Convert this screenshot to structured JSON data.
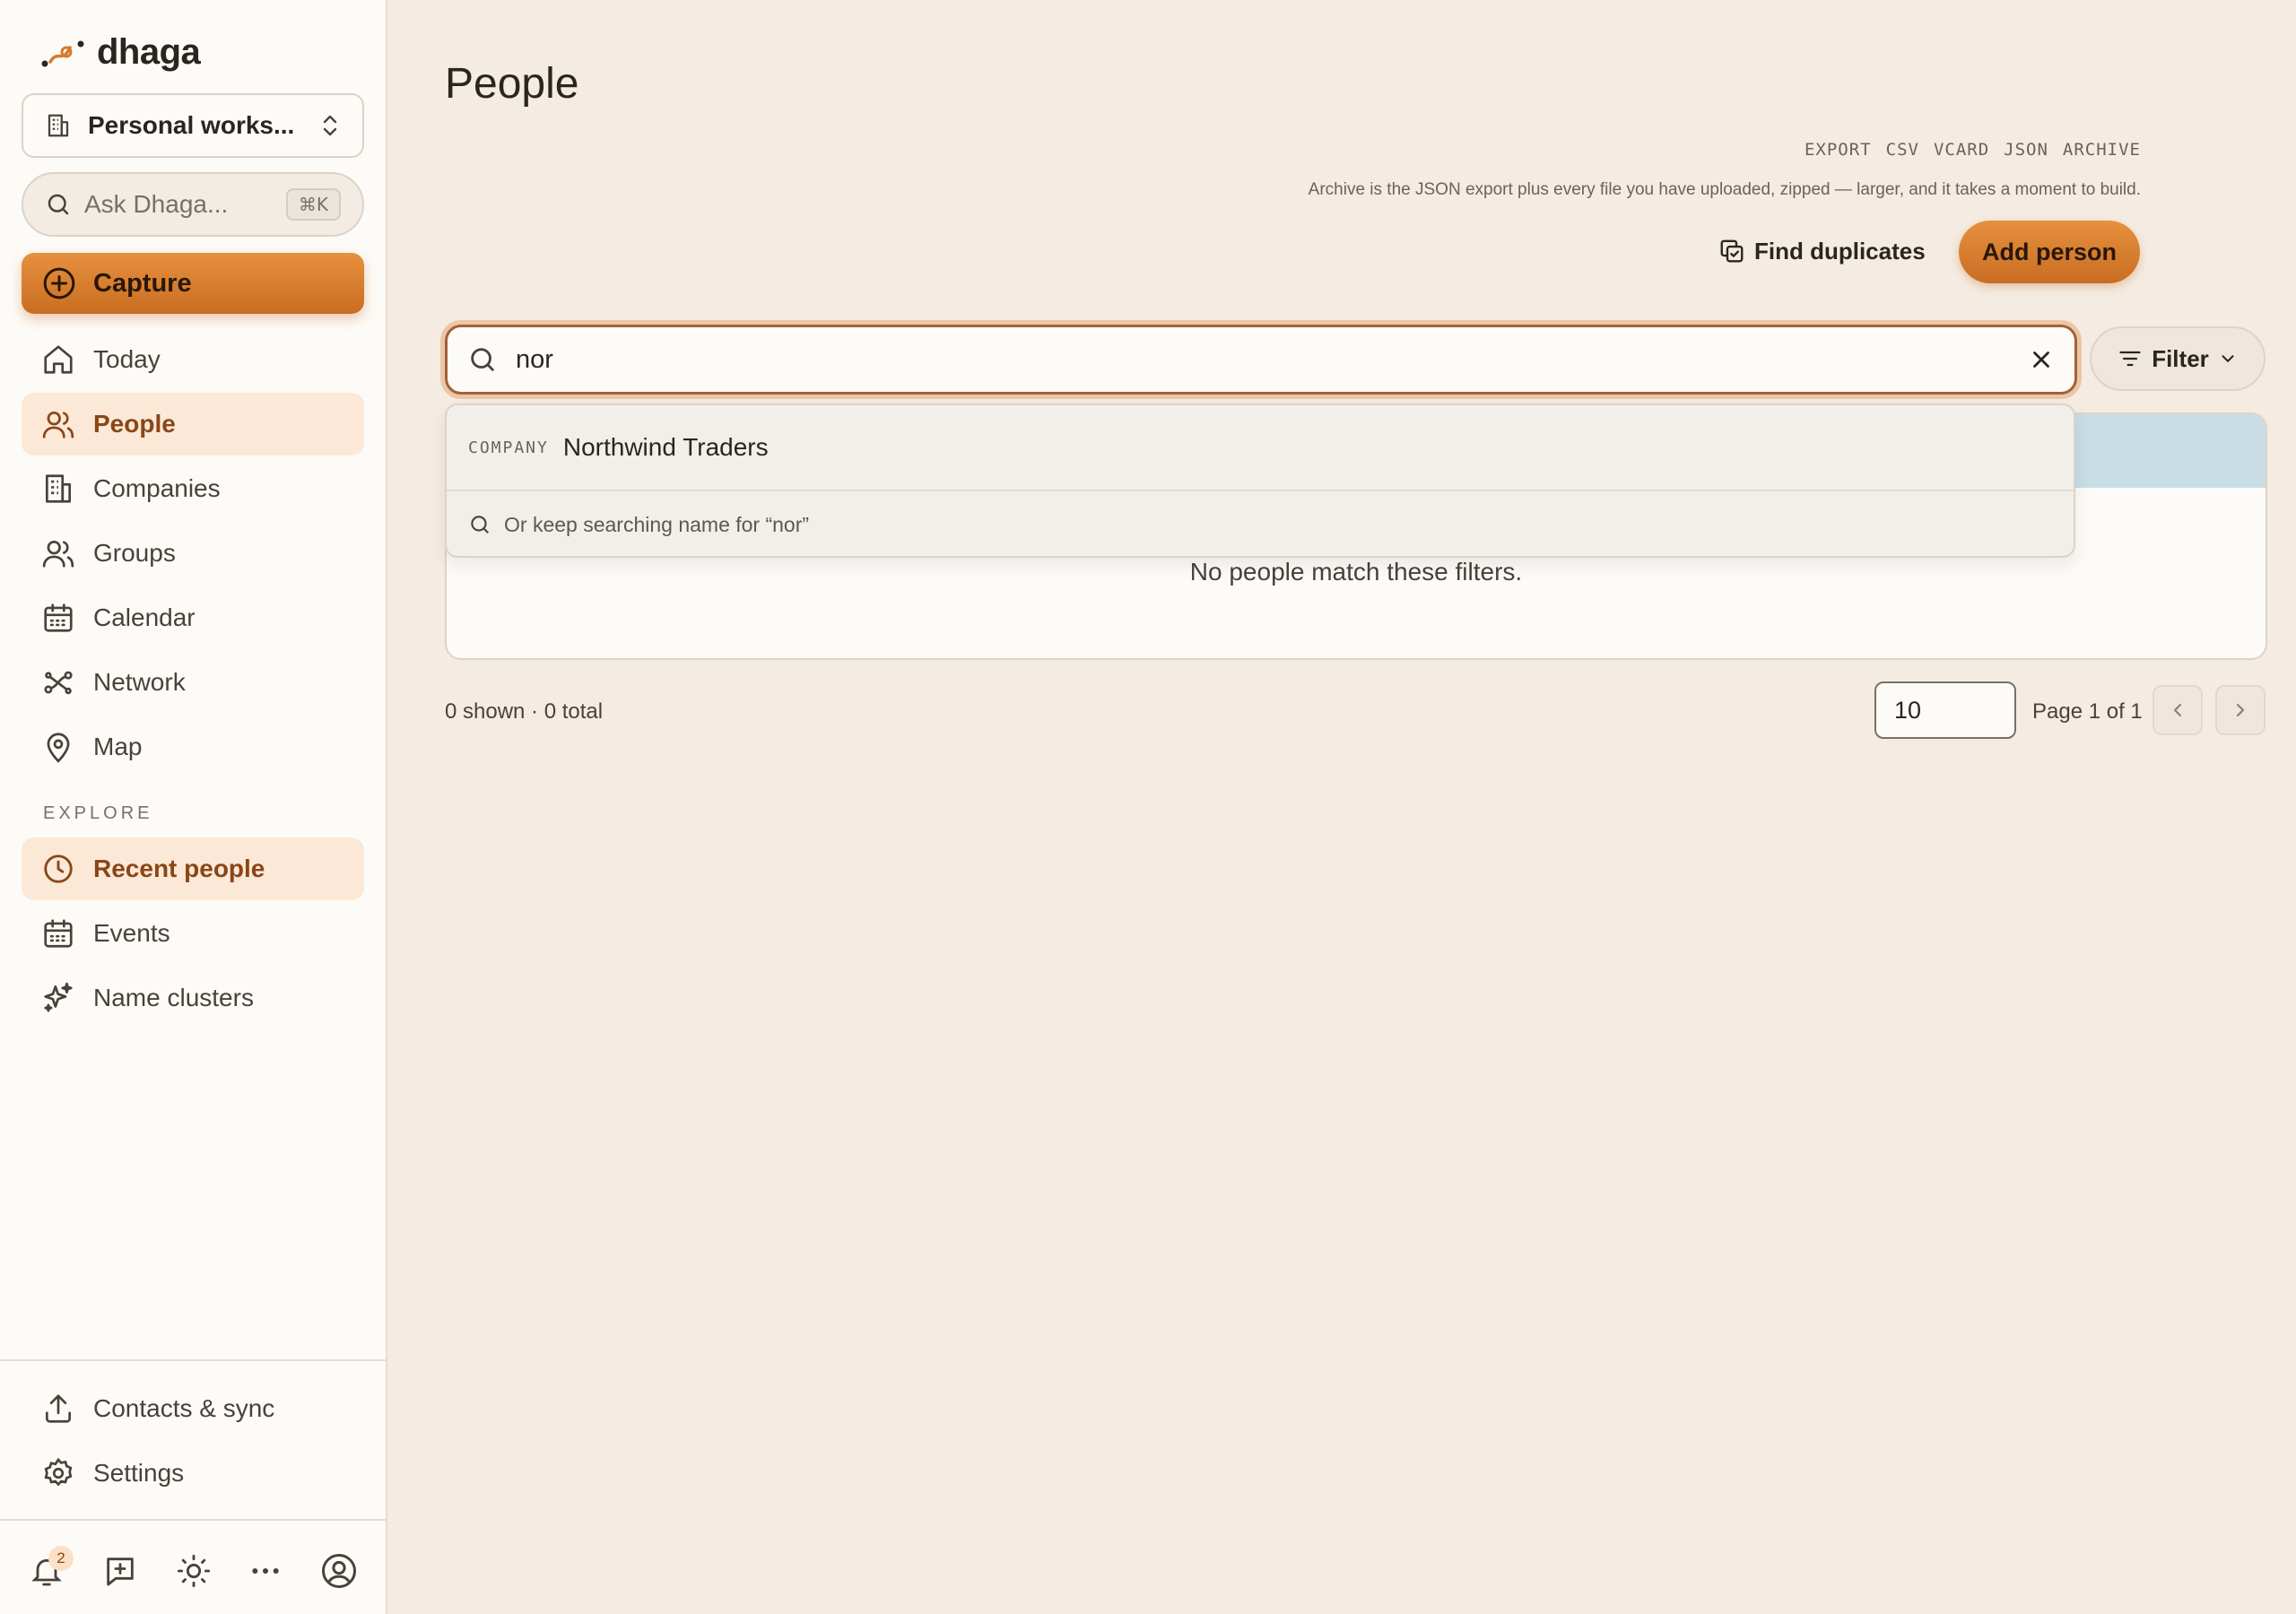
{
  "brand": {
    "name": "dhaga"
  },
  "workspace": {
    "label": "Personal works..."
  },
  "ask": {
    "placeholder": "Ask Dhaga...",
    "shortcut": "⌘K"
  },
  "capture": {
    "label": "Capture"
  },
  "nav": {
    "primary": [
      {
        "label": "Today",
        "icon": "home-icon"
      },
      {
        "label": "People",
        "icon": "users-icon",
        "active": true
      },
      {
        "label": "Companies",
        "icon": "building-icon"
      },
      {
        "label": "Groups",
        "icon": "group-icon"
      },
      {
        "label": "Calendar",
        "icon": "calendar-icon"
      },
      {
        "label": "Network",
        "icon": "network-icon"
      },
      {
        "label": "Map",
        "icon": "map-pin-icon"
      }
    ],
    "explore_label": "EXPLORE",
    "explore": [
      {
        "label": "Recent people",
        "icon": "clock-icon",
        "active": true
      },
      {
        "label": "Events",
        "icon": "calendar-icon"
      },
      {
        "label": "Name clusters",
        "icon": "sparkles-icon"
      }
    ],
    "footer": [
      {
        "label": "Contacts & sync",
        "icon": "upload-icon"
      },
      {
        "label": "Settings",
        "icon": "gear-icon"
      }
    ]
  },
  "bottom_bar": {
    "notification_count": "2"
  },
  "page": {
    "title": "People"
  },
  "export": {
    "items": [
      "EXPORT",
      "CSV",
      "VCARD",
      "JSON",
      "ARCHIVE"
    ],
    "note": "Archive is the JSON export plus every file you have uploaded, zipped — larger, and it takes a moment to build."
  },
  "actions": {
    "find_duplicates": "Find duplicates",
    "add_person": "Add person"
  },
  "search": {
    "value": "nor",
    "filter_label": "Filter"
  },
  "dropdown": {
    "company_kind": "COMPANY",
    "company_name": "Northwind Traders",
    "keep_searching": "Or keep searching name for “nor”"
  },
  "table": {
    "empty_message": "No people match these filters."
  },
  "pagination": {
    "summary": "0 shown · 0 total",
    "page_size": "10",
    "page_label": "Page 1 of 1"
  },
  "colors": {
    "accent": "#d7792c",
    "active_bg": "#fbe8d6",
    "background": "#f4ece2",
    "sidebar": "#fdfbf7"
  }
}
